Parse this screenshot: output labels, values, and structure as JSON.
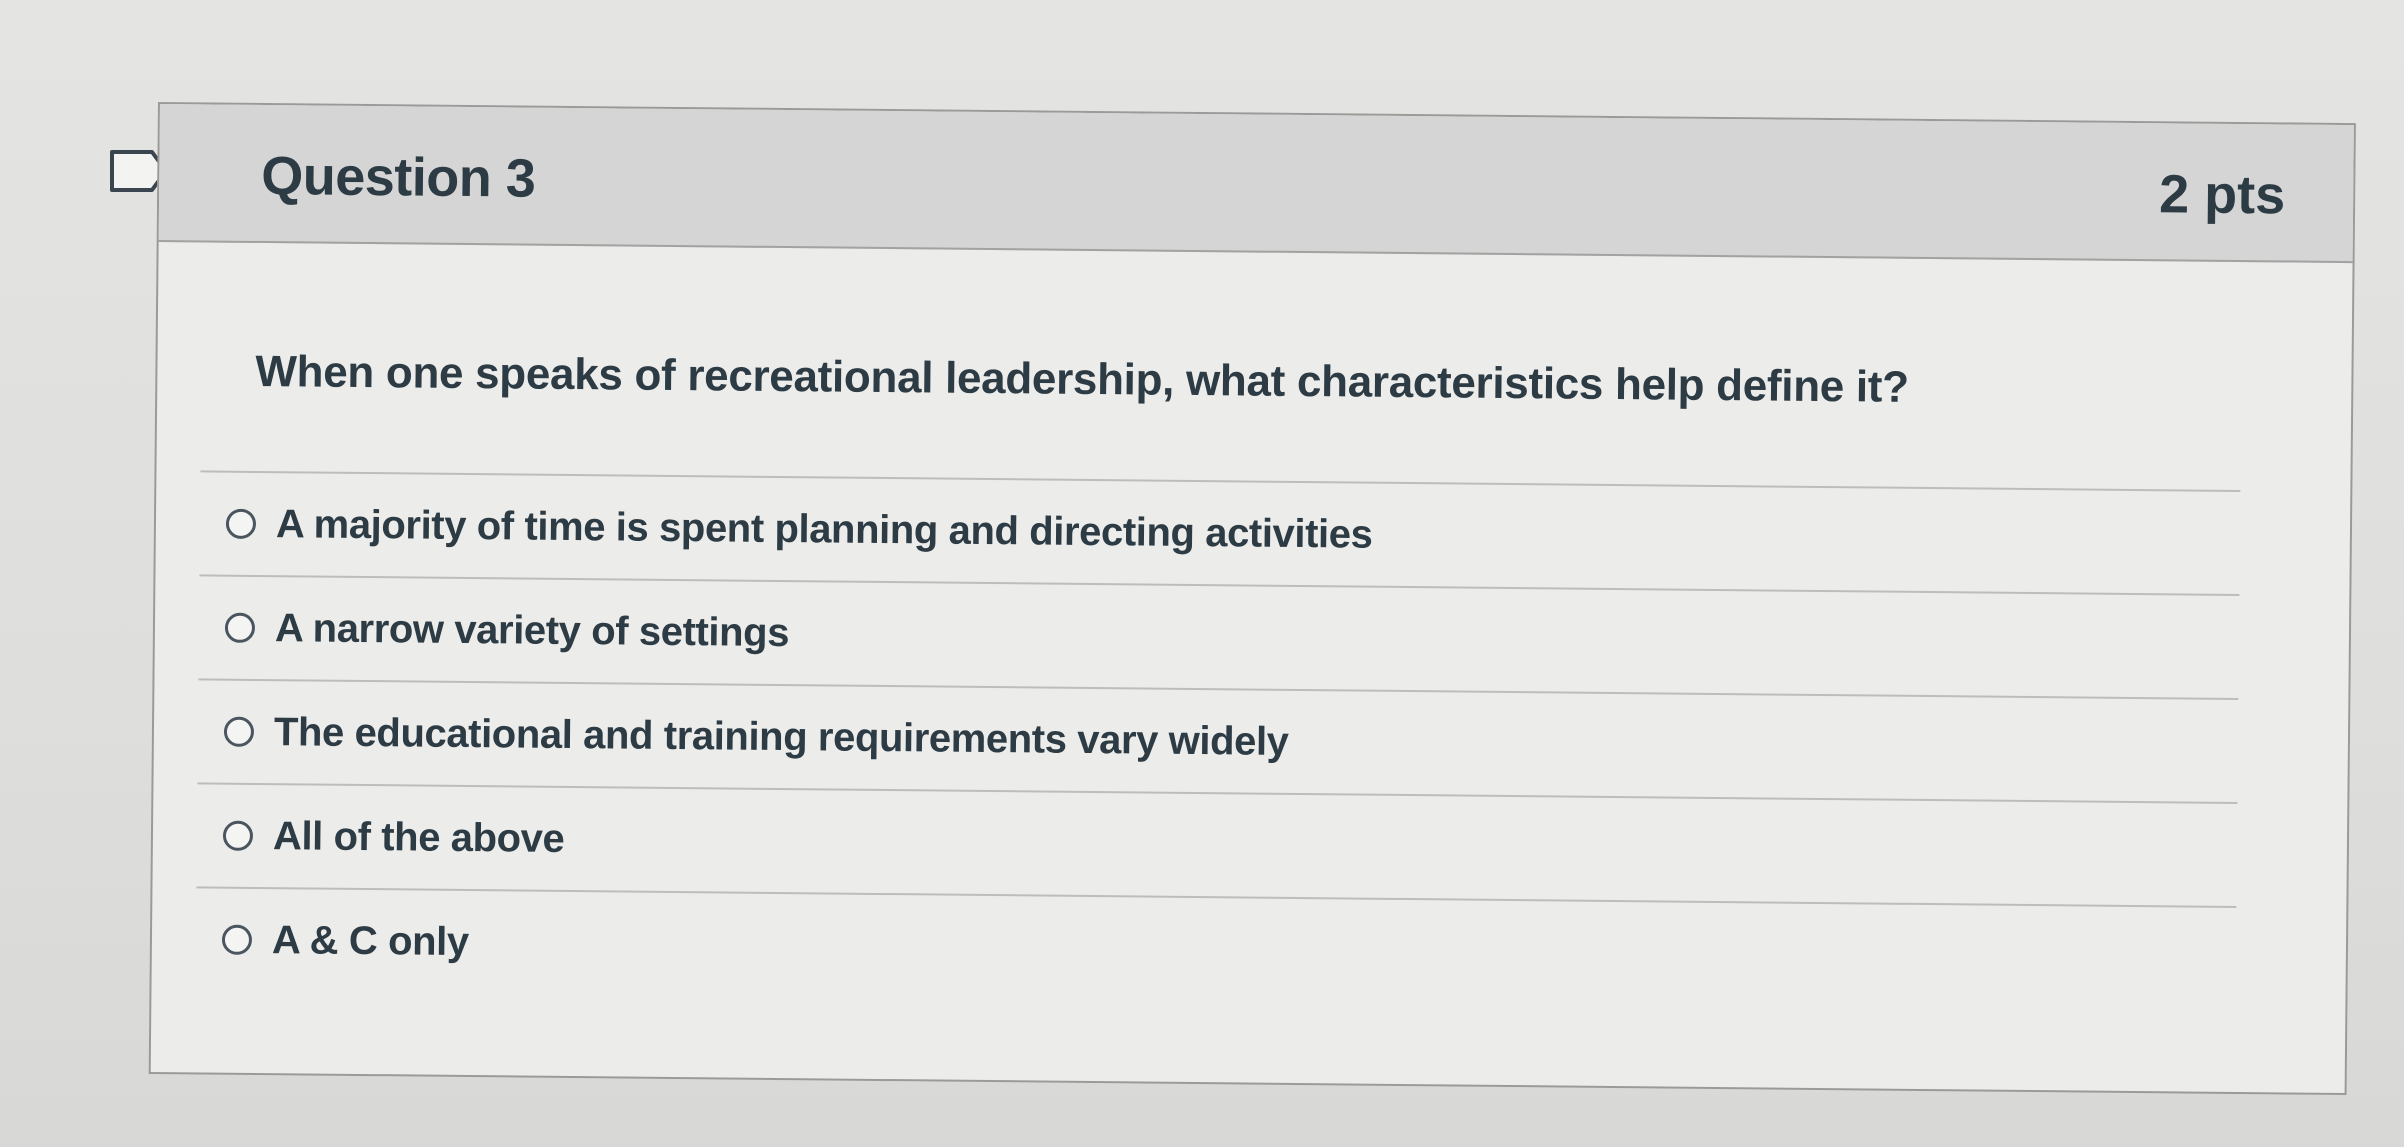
{
  "question": {
    "title": "Question 3",
    "points": "2 pts",
    "text": "When one speaks of recreational leadership, what characteristics help define it?",
    "flag_icon": "bookmark-flag-icon",
    "answers": [
      {
        "label": "A majority of time is spent planning and directing activities",
        "selected": false
      },
      {
        "label": "A narrow variety of settings",
        "selected": false
      },
      {
        "label": "The educational and training requirements vary widely",
        "selected": false
      },
      {
        "label": "All of the above",
        "selected": false
      },
      {
        "label": "A & C only",
        "selected": false
      }
    ]
  },
  "colors": {
    "header_background": "#d4d5d4",
    "card_background": "#ececea",
    "text": "#2d3b45"
  }
}
